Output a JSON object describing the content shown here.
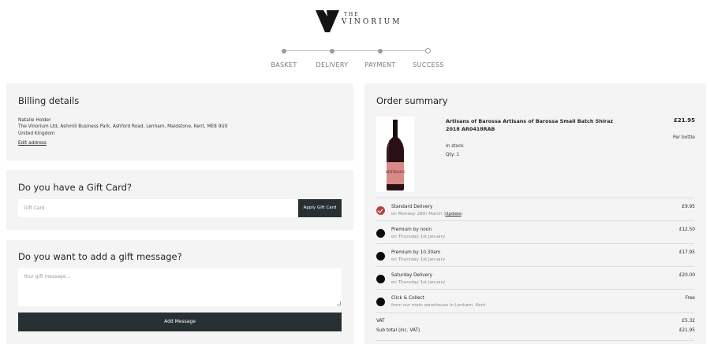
{
  "brand": {
    "the": "THE",
    "name": "VINORIUM"
  },
  "steps": [
    {
      "label": "BASKET"
    },
    {
      "label": "DELIVERY"
    },
    {
      "label": "PAYMENT"
    },
    {
      "label": "SUCCESS"
    }
  ],
  "billing": {
    "title": "Billing details",
    "name": "Natalie Holder",
    "address": "The Vinorium Ltd, Ashmill Business Park, Ashford Road, Lenham, Maidstone, Kent, ME8 9UX",
    "country": "United Kingdom",
    "edit_label": "Edit address"
  },
  "gift_card": {
    "title": "Do you have a Gift Card?",
    "placeholder": "Gift Card",
    "apply_label": "Apply Gift Card"
  },
  "gift_message": {
    "title": "Do you want to add a gift message?",
    "placeholder": "Your gift message...",
    "add_label": "Add Message"
  },
  "order": {
    "title": "Order summary",
    "product": {
      "name": "Artisans of Barossa Artisans of Barossa Small Batch Shiraz 2018 AR0418RAB",
      "price": "£21.95",
      "unit": "Per bottle",
      "stock": "In stock",
      "qty": "Qty: 1",
      "label_text": "ARTISANS"
    },
    "shipping": [
      {
        "name": "Standard Delivery",
        "sub": "on Monday 28th March (",
        "link": "Update",
        "sub_end": ")",
        "price": "£9.95",
        "selected": true
      },
      {
        "name": "Premium by noon",
        "sub": "on Thursday 1st January",
        "price": "£12.50",
        "selected": false
      },
      {
        "name": "Premium by 10.30am",
        "sub": "on Thursday 1st January",
        "price": "£17.95",
        "selected": false
      },
      {
        "name": "Saturday Delivery",
        "sub": "on Thursday 1st January",
        "price": "£20.00",
        "selected": false
      },
      {
        "name": "Click & Collect",
        "sub": "from our main warehouse in Lenham, Kent",
        "price": "Free",
        "selected": false
      }
    ],
    "vat_label": "VAT",
    "vat_value": "£5.32",
    "subtotal_label": "Sub total (inc. VAT)",
    "subtotal_value": "£21.95"
  },
  "colors": {
    "accent_dark": "#283033",
    "selected_radio": "#b14745",
    "panel_bg": "#f4f4f4"
  }
}
